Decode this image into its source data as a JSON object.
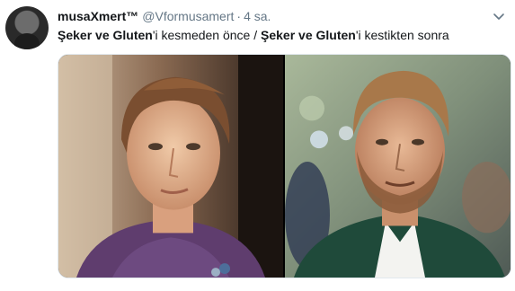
{
  "tweet": {
    "display_name": "musaXmert™",
    "handle": "@Vformusamert",
    "separator": "·",
    "time": "4 sa.",
    "text": {
      "part1_bold": "Şeker ve Gluten",
      "part1_rest": "'i kesmeden önce / ",
      "part2_bold": "Şeker ve Gluten",
      "part2_rest": "'i kestikten sonra"
    }
  },
  "icons": {
    "avatar": "avatar",
    "menu": "chevron-down-icon"
  },
  "colors": {
    "name": "#14171a",
    "secondary": "#657786",
    "border": "#e1e8ed"
  }
}
